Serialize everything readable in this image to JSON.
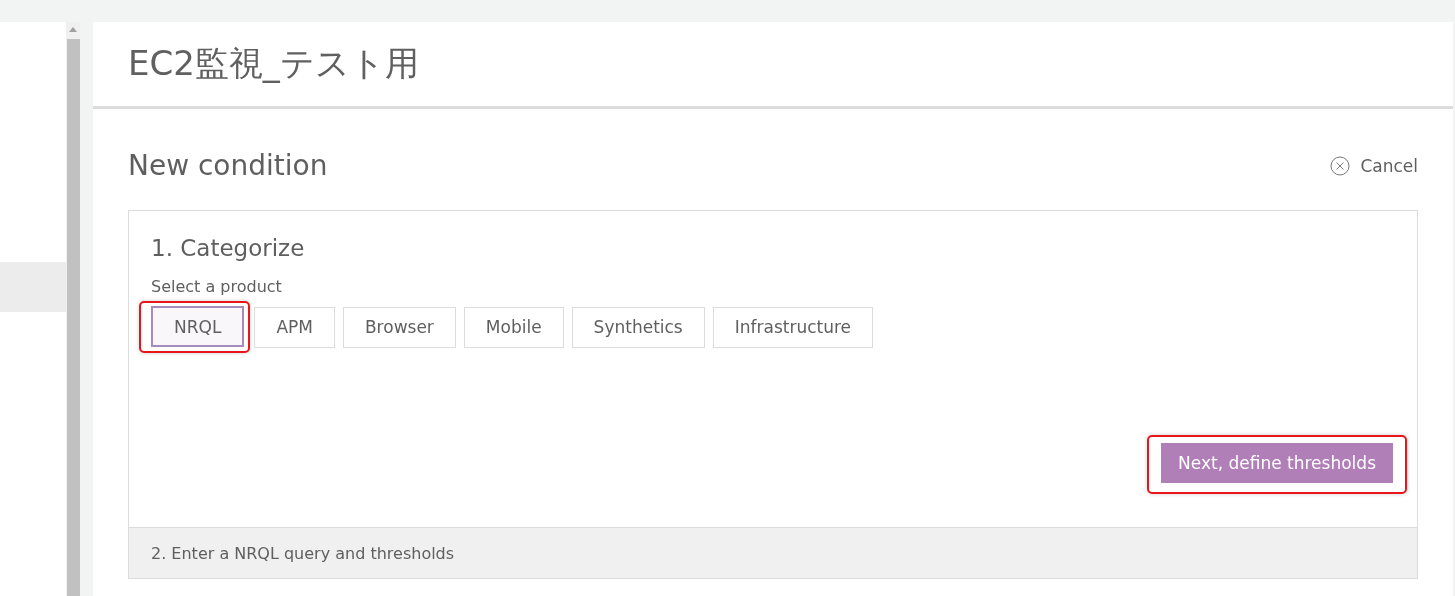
{
  "sidebar": {
    "items": [
      {
        "selected": true
      }
    ]
  },
  "header": {
    "title": "EC2監視_テスト用"
  },
  "form": {
    "title": "New condition",
    "cancel": "Cancel",
    "step_1": {
      "title": "1. Categorize",
      "label": "Select a product",
      "products": [
        {
          "label": "NRQL",
          "selected": true,
          "annotated": true
        },
        {
          "label": "APM",
          "selected": false,
          "annotated": false
        },
        {
          "label": "Browser",
          "selected": false,
          "annotated": false
        },
        {
          "label": "Mobile",
          "selected": false,
          "annotated": false
        },
        {
          "label": "Synthetics",
          "selected": false,
          "annotated": false
        },
        {
          "label": "Infrastructure",
          "selected": false,
          "annotated": false
        }
      ],
      "next_button": {
        "label": "Next, define thresholds",
        "annotated": true
      }
    },
    "step_2": {
      "title": "2. Enter a NRQL query and thresholds"
    }
  }
}
